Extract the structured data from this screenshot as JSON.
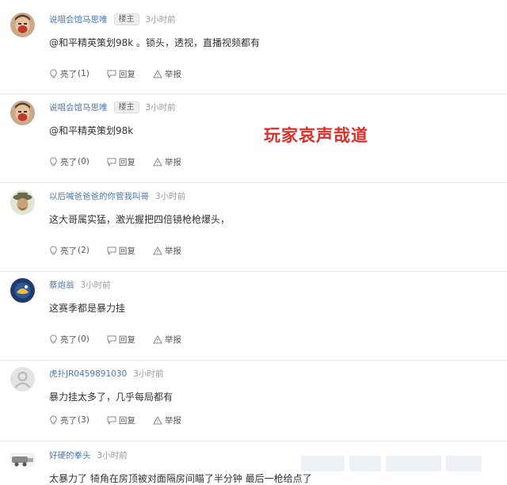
{
  "comments": [
    {
      "username": "说唱会馆马思唯",
      "badge": "楼主",
      "time": "3小时前",
      "text": "@和平精英策划98k 。锁头，透视，直播视频都有",
      "like_label": "亮了",
      "like_count": "(1)",
      "reply_label": "回复",
      "report_label": "举报"
    },
    {
      "username": "说唱会馆马思唯",
      "badge": "楼主",
      "time": "3小时前",
      "text": "@和平精英策划98k",
      "like_label": "亮了",
      "like_count": "(0)",
      "reply_label": "回复",
      "report_label": "举报"
    },
    {
      "username": "以后喊爸爸爸的你管我叫哥",
      "time": "3小时前",
      "text": "这大哥属实猛，激光握把四倍镜枪枪爆头，",
      "like_label": "亮了",
      "like_count": "(2)",
      "reply_label": "回复",
      "report_label": "举报"
    },
    {
      "username": "蔡炮翁",
      "time": "3小时前",
      "text": "这赛季都是暴力挂",
      "like_label": "亮了",
      "like_count": "(0)",
      "reply_label": "回复",
      "report_label": "举报"
    },
    {
      "username": "虎扑JR0459891030",
      "time": "3小时前",
      "text": "暴力挂太多了，几乎每局都有",
      "like_label": "亮了",
      "like_count": "(3)",
      "reply_label": "回复",
      "report_label": "举报"
    },
    {
      "username": "好硬的拳头",
      "time": "3小时前",
      "text": "太暴力了 犄角在房顶被对面隔房间瞄了半分钟 最后一枪给点了"
    }
  ],
  "overlay_caption": "玩家哀声哉道",
  "colors": {
    "username": "#4a78b0",
    "caption": "#d9302b",
    "divider": "#ececec"
  }
}
